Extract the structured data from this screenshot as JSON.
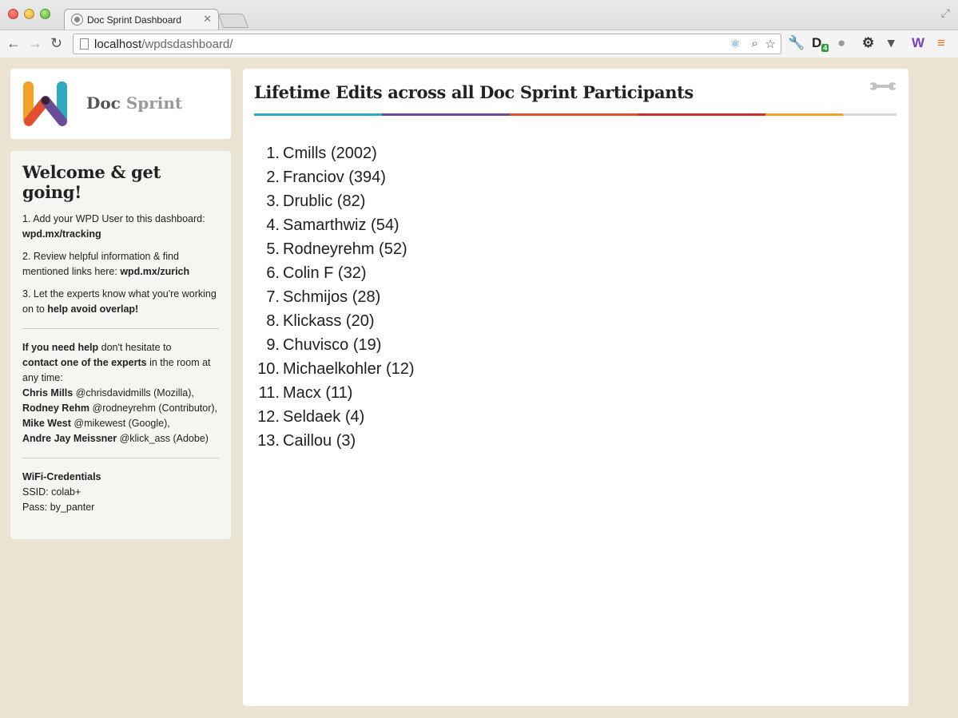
{
  "browser": {
    "tab_title": "Doc Sprint Dashboard",
    "url_host": "localhost",
    "url_path": "/wpdsdashboard/",
    "extension_badge": "4"
  },
  "logo": {
    "word1": "Doc",
    "word2": "Sprint"
  },
  "sidebar": {
    "heading": "Welcome & get going!",
    "step1_text": "1. Add your WPD User to this dashboard:",
    "step1_link": "wpd.mx/tracking",
    "step2_text": "2. Review helpful information & find mentioned links here:",
    "step2_link": "wpd.mx/zurich",
    "step3_text": "3. Let the experts know what you're working on to",
    "step3_bold": "help avoid overlap!",
    "help_bold1": "If you need help",
    "help_text1": "don't hesitate to",
    "help_bold2": "contact one of the experts",
    "help_text2": "in the room at any time:",
    "experts": [
      {
        "name": "Chris Mills",
        "detail": "@chrisdavidmills (Mozilla),"
      },
      {
        "name": "Rodney Rehm",
        "detail": "@rodneyrehm (Contributor),"
      },
      {
        "name": "Mike West",
        "detail": "@mikewest (Google),"
      },
      {
        "name": "Andre Jay Meissner",
        "detail": "@klick_ass (Adobe)"
      }
    ],
    "wifi_heading": "WiFi-Credentials",
    "wifi_ssid": "SSID: colab+",
    "wifi_pass": "Pass: by_panter"
  },
  "main": {
    "title": "Lifetime Edits across all Doc Sprint Participants",
    "rule_colors": [
      "#2eaac1",
      "#6b4c9a",
      "#e0502e",
      "#cf2f2f",
      "#f3a229"
    ],
    "leaders": [
      {
        "rank": "1.",
        "entry": "Cmills (2002)"
      },
      {
        "rank": "2.",
        "entry": "Franciov (394)"
      },
      {
        "rank": "3.",
        "entry": "Drublic (82)"
      },
      {
        "rank": "4.",
        "entry": "Samarthwiz (54)"
      },
      {
        "rank": "5.",
        "entry": "Rodneyrehm (52)"
      },
      {
        "rank": "6.",
        "entry": "Colin F (32)"
      },
      {
        "rank": "7.",
        "entry": "Schmijos (28)"
      },
      {
        "rank": "8.",
        "entry": "Klickass (20)"
      },
      {
        "rank": "9.",
        "entry": "Chuvisco (19)"
      },
      {
        "rank": "10.",
        "entry": "Michaelkohler (12)"
      },
      {
        "rank": "11.",
        "entry": "Macx (11)"
      },
      {
        "rank": "12.",
        "entry": "Seldaek (4)"
      },
      {
        "rank": "13.",
        "entry": "Caillou (3)"
      }
    ]
  }
}
